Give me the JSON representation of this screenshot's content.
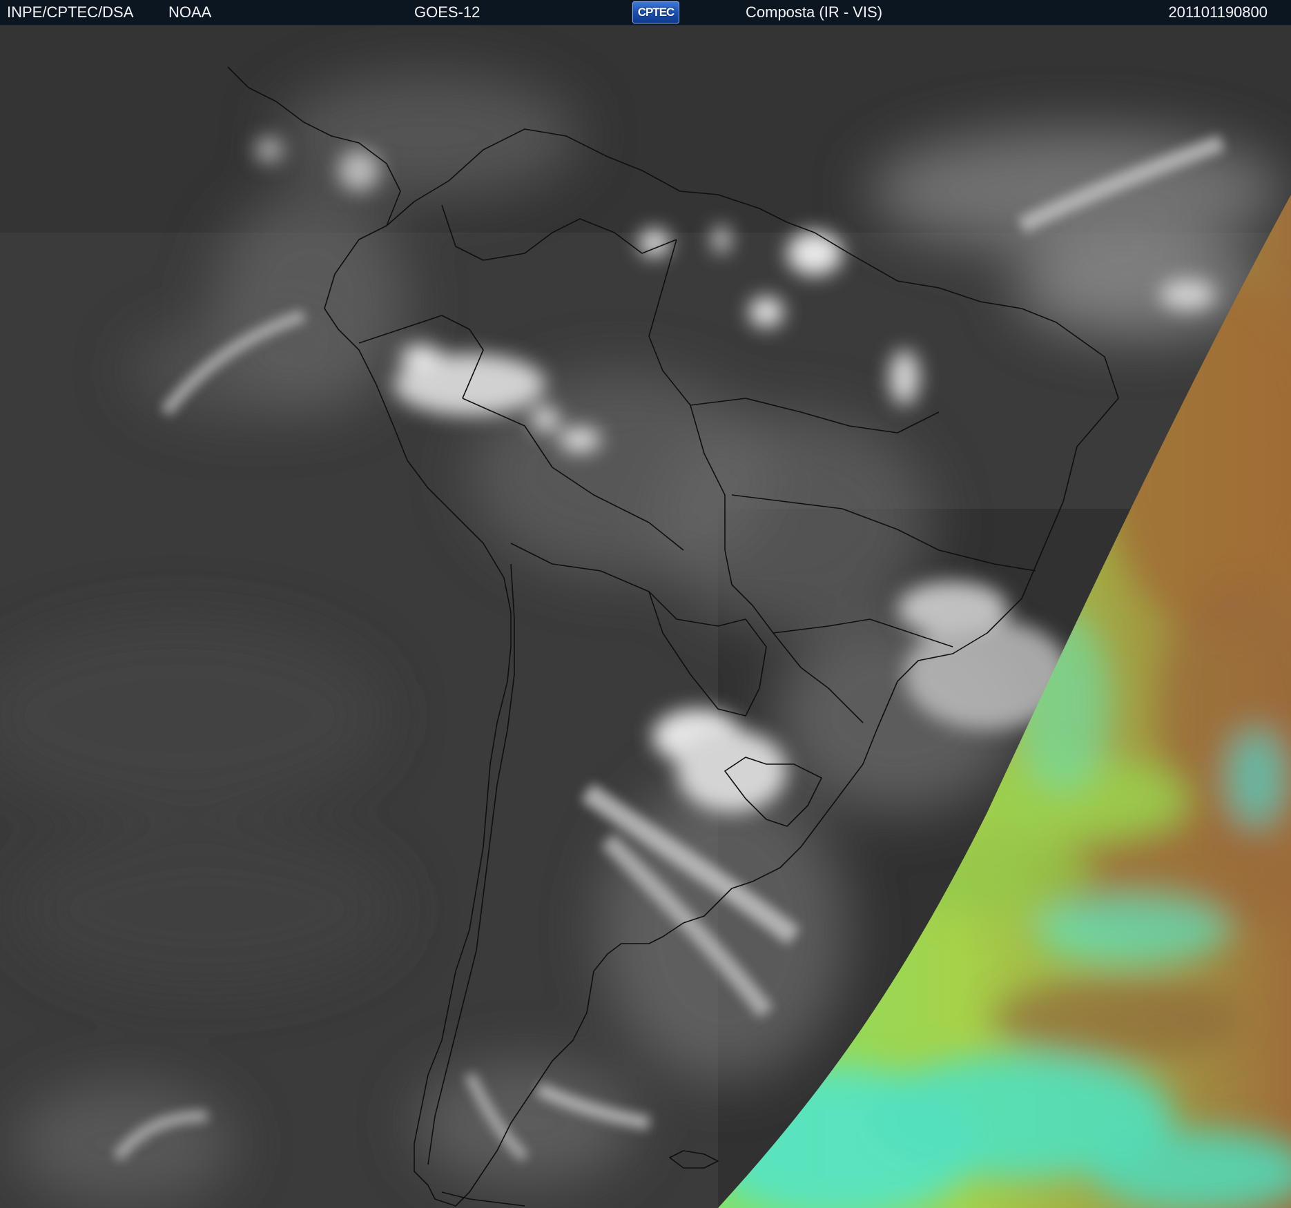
{
  "header": {
    "organization": "INPE/CPTEC/DSA",
    "agency": "NOAA",
    "satellite": "GOES-12",
    "logo_text": "CPTEC",
    "product": "Composta (IR - VIS)",
    "timestamp": "201101190800"
  },
  "imagery": {
    "icon": "satellite-composite-image",
    "colors": {
      "header_bg": "#0c1620",
      "ir_background": "#3d3d3d",
      "cloud": "#cfcfcf",
      "vis_green": "#9bd94a",
      "vis_cyan": "#5ae6c0",
      "vis_brown": "#9a6a3a",
      "coastline": "#101010"
    }
  }
}
